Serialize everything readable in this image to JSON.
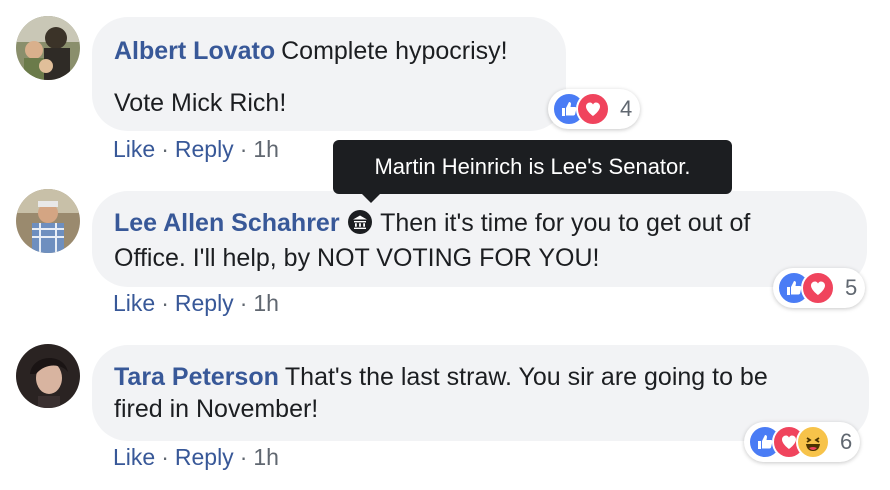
{
  "comments": [
    {
      "author": "Albert Lovato",
      "line1": "Complete hypocrisy!",
      "line2": "Vote Mick Rich!",
      "reaction_count": "4",
      "reactions": [
        "like-icon",
        "love-icon"
      ],
      "actions": {
        "like": "Like",
        "reply": "Reply",
        "time": "1h"
      }
    },
    {
      "author": "Lee Allen Schahrer",
      "badge_icon": "government-building-icon",
      "line1": "Then it's time for you to get out of",
      "line2": "Office. I'll help, by NOT VOTING FOR YOU!",
      "reaction_count": "5",
      "reactions": [
        "like-icon",
        "love-icon"
      ],
      "actions": {
        "like": "Like",
        "reply": "Reply",
        "time": "1h"
      }
    },
    {
      "author": "Tara Peterson",
      "line1": "That's the last straw. You sir are going to be",
      "line2": "fired in November!",
      "reaction_count": "6",
      "reactions": [
        "like-icon",
        "love-icon",
        "haha-icon"
      ],
      "actions": {
        "like": "Like",
        "reply": "Reply",
        "time": "1h"
      }
    }
  ],
  "tooltip": {
    "text": "Martin Heinrich is Lee's Senator."
  },
  "separator": "·",
  "colors": {
    "bubble": "#f2f3f5",
    "author": "#385898",
    "like": "#4a7cf5",
    "love": "#f0445d",
    "haha": "#f7c34a",
    "tooltip_bg": "#1c1e21"
  }
}
